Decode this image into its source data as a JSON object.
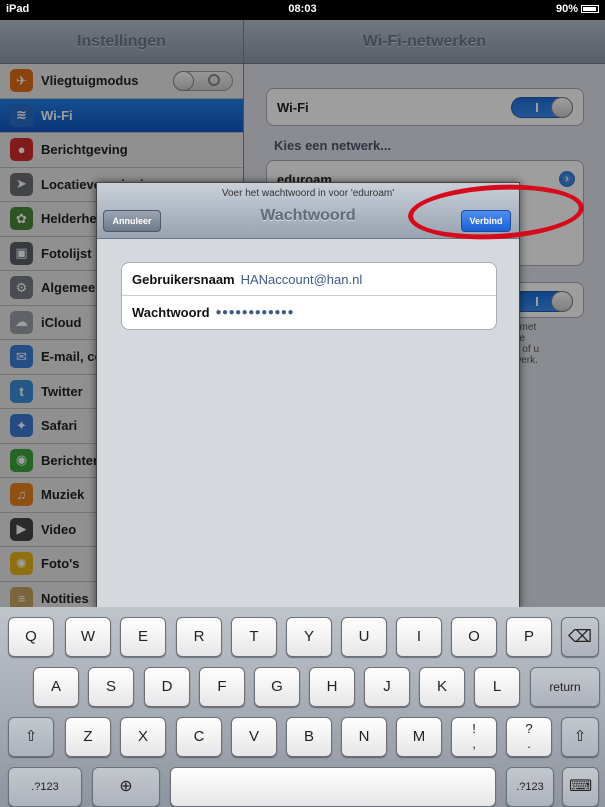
{
  "status_bar": {
    "device": "iPad",
    "time": "08:03",
    "battery": "90%"
  },
  "master": {
    "title": "Instellingen",
    "items": [
      {
        "label": "Vliegtuigmodus",
        "icon": "airplane-icon",
        "color": "#e36d18"
      },
      {
        "label": "Wi-Fi",
        "icon": "wifi-icon",
        "color": "#2a6fc9"
      },
      {
        "label": "Berichtgeving",
        "icon": "notification-icon",
        "color": "#d32a2a"
      },
      {
        "label": "Locatievoorzieningen",
        "icon": "location-icon",
        "color": "#6b6f75"
      },
      {
        "label": "Helderheid & achtergrond",
        "icon": "brightness-icon",
        "color": "#4a8a3a"
      },
      {
        "label": "Fotolijst",
        "icon": "photo-frame-icon",
        "color": "#5a5f66"
      },
      {
        "label": "Algemeen",
        "icon": "gear-icon",
        "color": "#777b82"
      },
      {
        "label": "iCloud",
        "icon": "cloud-icon",
        "color": "#9aa0a8"
      },
      {
        "label": "E-mail, contacten, agenda",
        "icon": "mail-icon",
        "color": "#3d7fd6"
      },
      {
        "label": "Twitter",
        "icon": "twitter-icon",
        "color": "#3d8fd8"
      },
      {
        "label": "Safari",
        "icon": "compass-icon",
        "color": "#3a7bd2"
      },
      {
        "label": "Berichten",
        "icon": "message-icon",
        "color": "#3ca53c"
      },
      {
        "label": "Muziek",
        "icon": "music-icon",
        "color": "#e8811c"
      },
      {
        "label": "Video",
        "icon": "video-icon",
        "color": "#444"
      },
      {
        "label": "Foto's",
        "icon": "sunflower-icon",
        "color": "#e5b51c"
      },
      {
        "label": "Notities",
        "icon": "notes-icon",
        "color": "#c9a45c"
      }
    ]
  },
  "detail": {
    "title": "Wi-Fi-netwerken",
    "wifi_label": "Wi-Fi",
    "choose_network": "Kies een netwerk...",
    "network": "eduroam",
    "note_lines": [
      "t met",
      "de",
      "d of u",
      "werk."
    ]
  },
  "modal": {
    "prompt": "Voer het wachtwoord in voor 'eduroam'",
    "title": "Wachtwoord",
    "cancel_label": "Annuleer",
    "connect_label": "Verbind",
    "username_label": "Gebruikersnaam",
    "username_value": "HANaccount@han.nl",
    "password_label": "Wachtwoord",
    "password_value": "●●●●●●●●●●●●"
  },
  "keyboard": {
    "row1": [
      "Q",
      "W",
      "E",
      "R",
      "T",
      "Y",
      "U",
      "I",
      "O",
      "P"
    ],
    "row2": [
      "A",
      "S",
      "D",
      "F",
      "G",
      "H",
      "J",
      "K",
      "L"
    ],
    "row3": [
      "Z",
      "X",
      "C",
      "V",
      "B",
      "N",
      "M"
    ],
    "return_label": "return",
    "numbers_label": ".?123",
    "excl_key": "!\n,",
    "question_key": "?\n.",
    "backspace": "⌫",
    "shift": "⇧",
    "globe": "⊕",
    "hide_keyboard": "⌨"
  },
  "annotation": {
    "color": "#d60a1c"
  }
}
